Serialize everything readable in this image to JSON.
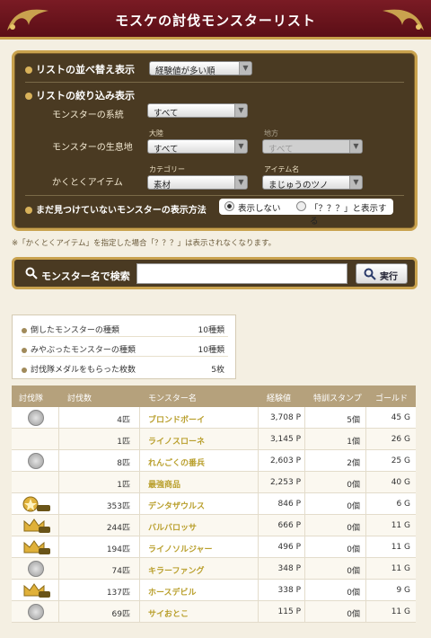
{
  "header": {
    "title": "モスケの討伐モンスターリスト"
  },
  "filter": {
    "sort_label": "リストの並べ替え表示",
    "sort_value": "経験値が多い順",
    "narrow_label": "リストの絞り込み表示",
    "lineage_label": "モンスターの系統",
    "lineage_value": "すべて",
    "habitat_label": "モンスターの生息地",
    "continent_label": "大陸",
    "continent_value": "すべて",
    "region_label": "地方",
    "region_value": "すべて",
    "item_label": "かくとくアイテム",
    "category_label": "カテゴリー",
    "category_value": "素材",
    "itemname_label": "アイテム名",
    "itemname_value": "まじゅうのツノ",
    "unseen_label": "まだ見つけていないモンスターの表示方法",
    "radio_hide": "表示しない",
    "radio_show": "「？？？」と表示する"
  },
  "note": "※「かくとくアイテム」を指定した場合「？？？」は表示されなくなります。",
  "search": {
    "label": "モンスター名で検索",
    "input_value": "",
    "button": "実行"
  },
  "stats": [
    {
      "label": "倒したモンスターの種類",
      "value": "10種類"
    },
    {
      "label": "みやぶったモンスターの種類",
      "value": "10種類"
    },
    {
      "label": "討伐隊メダルをもらった枚数",
      "value": "5枚"
    }
  ],
  "table": {
    "headers": [
      "討伐隊",
      "討伐数",
      "モンスター名",
      "経験値",
      "特訓スタンプ",
      "ゴールド"
    ],
    "rows": [
      {
        "medal": "silver",
        "count": "4匹",
        "name": "ブロンドボーイ",
        "exp": "3,708 P",
        "stamp": "5個",
        "gold": "45 G"
      },
      {
        "medal": "none",
        "count": "1匹",
        "name": "ライノスローネ",
        "exp": "3,145 P",
        "stamp": "1個",
        "gold": "26 G"
      },
      {
        "medal": "silver",
        "count": "8匹",
        "name": "れんごくの番兵",
        "exp": "2,603 P",
        "stamp": "2個",
        "gold": "25 G"
      },
      {
        "medal": "none",
        "count": "1匹",
        "name": "最強商品",
        "exp": "2,253 P",
        "stamp": "0個",
        "gold": "40 G"
      },
      {
        "medal": "gold300",
        "count": "353匹",
        "name": "デンタザウルス",
        "exp": "846 P",
        "stamp": "0個",
        "gold": "6 G"
      },
      {
        "medal": "crown200",
        "count": "244匹",
        "name": "バルバロッサ",
        "exp": "666 P",
        "stamp": "0個",
        "gold": "11 G"
      },
      {
        "medal": "crown100",
        "count": "194匹",
        "name": "ライノソルジャー",
        "exp": "496 P",
        "stamp": "0個",
        "gold": "11 G"
      },
      {
        "medal": "silver",
        "count": "74匹",
        "name": "キラーファング",
        "exp": "348 P",
        "stamp": "0個",
        "gold": "11 G"
      },
      {
        "medal": "crown100",
        "count": "137匹",
        "name": "ホースデビル",
        "exp": "338 P",
        "stamp": "0個",
        "gold": "9 G"
      },
      {
        "medal": "silver",
        "count": "69匹",
        "name": "サイおとこ",
        "exp": "115 P",
        "stamp": "0個",
        "gold": "11 G"
      }
    ]
  },
  "colors": {
    "header_bg": "#6a141d",
    "panel_bg": "#4a3a22",
    "gold_border": "#c9a24e",
    "name_text": "#b99f2c"
  }
}
